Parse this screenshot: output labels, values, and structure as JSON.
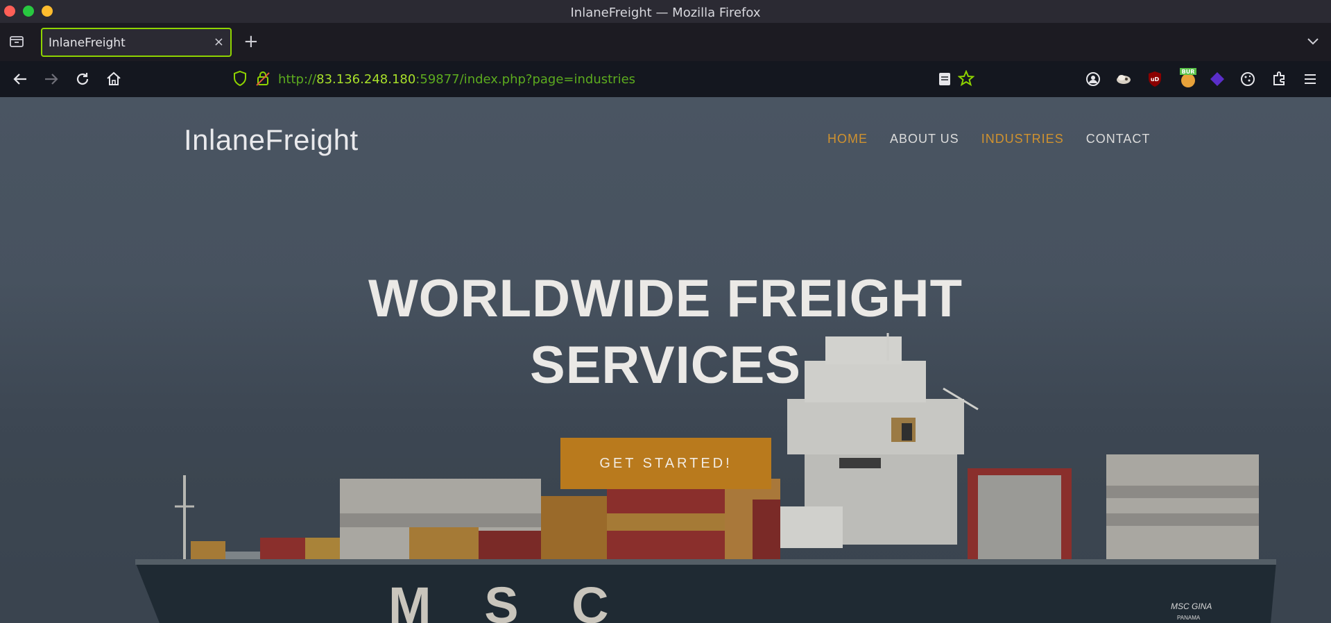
{
  "window": {
    "title": "InlaneFreight — Mozilla Firefox"
  },
  "tabs": [
    {
      "title": "InlaneFreight",
      "close": "×"
    }
  ],
  "new_tab_label": "+",
  "address_bar": {
    "scheme": "http://",
    "host": "83.136.248.180",
    "rest": ":59877/index.php?page=industries"
  },
  "site": {
    "logo": "InlaneFreight",
    "menu": [
      {
        "label": "HOME",
        "active": true
      },
      {
        "label": "ABOUT US",
        "active": false
      },
      {
        "label": "INDUSTRIES",
        "active": true
      },
      {
        "label": "CONTACT",
        "active": false
      }
    ],
    "hero_line1": "WORLDWIDE FREIGHT",
    "hero_line2": "SERVICES",
    "cta": "GET STARTED!",
    "ship_text": "M S C",
    "ship_name": "MSC GINA",
    "ship_port": "PANAMA"
  },
  "colors": {
    "accent": "#d0922f",
    "cta_bg": "#b97a1d",
    "url_green": "#5cab1f",
    "tab_border": "#8fd400"
  },
  "extension_icons": [
    "account-icon",
    "extension-icon",
    "ublock-icon",
    "burp-icon",
    "wappalyzer-icon",
    "cookie-icon",
    "puzzle-icon",
    "menu-icon"
  ]
}
